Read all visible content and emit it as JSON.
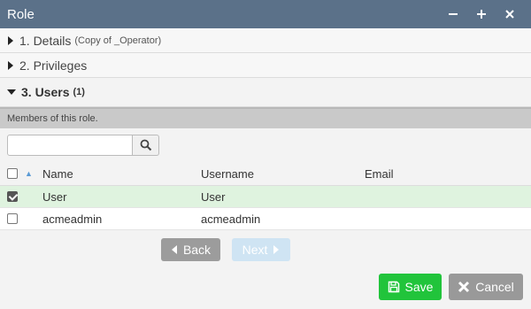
{
  "window": {
    "title": "Role",
    "minimize_label": "−",
    "maximize_label": "+",
    "close_label": "×"
  },
  "sections": {
    "details": {
      "label": "1. Details",
      "sub": "(Copy of _Operator)"
    },
    "privileges": {
      "label": "2. Privileges"
    },
    "users": {
      "label": "3. Users",
      "count": "(1)"
    }
  },
  "users_panel": {
    "description": "Members of this role.",
    "search": {
      "value": "",
      "placeholder": ""
    },
    "columns": {
      "name": "Name",
      "username": "Username",
      "email": "Email"
    },
    "rows": [
      {
        "checked": true,
        "name": "User",
        "username": "User",
        "email": ""
      },
      {
        "checked": false,
        "name": "acmeadmin",
        "username": "acmeadmin",
        "email": ""
      }
    ],
    "pager": {
      "back": "Back",
      "next": "Next"
    }
  },
  "footer": {
    "save": "Save",
    "cancel": "Cancel"
  },
  "colors": {
    "titlebar": "#5b7189",
    "save": "#21c43b",
    "cancel": "#999999",
    "selected_row": "#dff3df"
  }
}
